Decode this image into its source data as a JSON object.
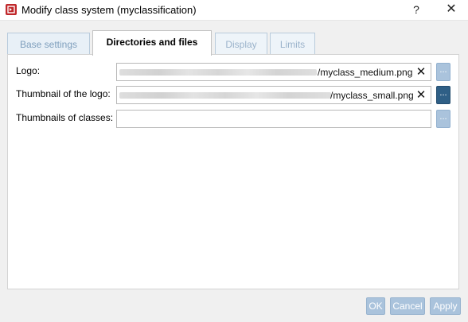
{
  "window": {
    "title": "Modify class system (myclassification)",
    "help_label": "?",
    "close_label": "✕"
  },
  "tabs": [
    {
      "label": "Base settings",
      "state": "inactive"
    },
    {
      "label": "Directories and files",
      "state": "active"
    },
    {
      "label": "Display",
      "state": "disabled"
    },
    {
      "label": "Limits",
      "state": "disabled"
    }
  ],
  "fields": {
    "logo": {
      "label": "Logo:",
      "value_suffix": "/myclass_medium.png",
      "clear_label": "✕",
      "browse_label": "..."
    },
    "thumbnail": {
      "label": "Thumbnail of the logo:",
      "value_suffix": "/myclass_small.png",
      "clear_label": "✕",
      "browse_label": "..."
    },
    "class_thumbnails": {
      "label": "Thumbnails of classes:",
      "value_suffix": "",
      "browse_label": "..."
    }
  },
  "buttons": {
    "ok": "OK",
    "cancel": "Cancel",
    "apply": "Apply"
  },
  "colors": {
    "accent_button": "#aac3dc",
    "active_browse": "#2f5f86",
    "app_icon": "#c0282b"
  }
}
